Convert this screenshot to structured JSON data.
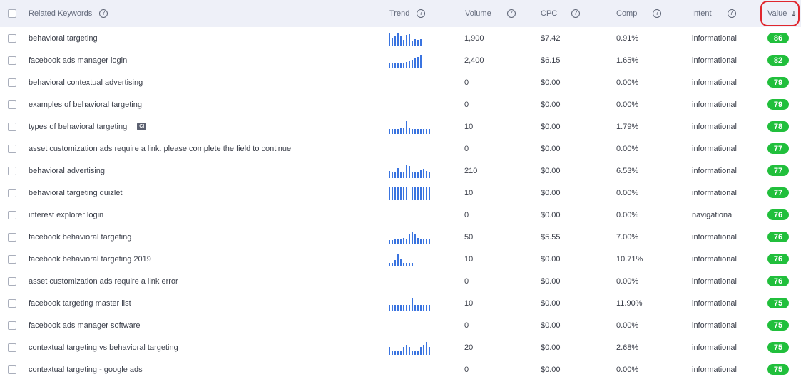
{
  "header": {
    "keyword_label": "Related Keywords",
    "trend_label": "Trend",
    "volume_label": "Volume",
    "cpc_label": "CPC",
    "comp_label": "Comp",
    "intent_label": "Intent",
    "value_label": "Value",
    "sort_icon": "arrow-down-icon",
    "help_icon": "help-circle-icon",
    "help_glyph": "?",
    "sort_glyph": "↓"
  },
  "colors": {
    "header_bg": "#eef0f8",
    "trend_bar": "#3a74e0",
    "value_pill": "#21bf3c",
    "highlight_ring": "#e0262d"
  },
  "rows": [
    {
      "keyword": "behavioral targeting",
      "volume": "1,900",
      "cpc": "$7.42",
      "comp": "0.91%",
      "intent": "informational",
      "value": "86",
      "trend": [
        0.95,
        0.55,
        0.75,
        1.0,
        0.7,
        0.45,
        0.85,
        0.9,
        0.4,
        0.5,
        0.45,
        0.5
      ]
    },
    {
      "keyword": "facebook ads manager login",
      "volume": "2,400",
      "cpc": "$6.15",
      "comp": "1.65%",
      "intent": "informational",
      "value": "82",
      "trend": [
        0.35,
        0.35,
        0.35,
        0.35,
        0.4,
        0.4,
        0.45,
        0.55,
        0.6,
        0.75,
        0.85,
        1.0
      ]
    },
    {
      "keyword": "behavioral contextual advertising",
      "volume": "0",
      "cpc": "$0.00",
      "comp": "0.00%",
      "intent": "informational",
      "value": "79",
      "trend": []
    },
    {
      "keyword": "examples of behavioral targeting",
      "volume": "0",
      "cpc": "$0.00",
      "comp": "0.00%",
      "intent": "informational",
      "value": "79",
      "trend": []
    },
    {
      "keyword": "types of behavioral targeting",
      "badge": "CI",
      "volume": "10",
      "cpc": "$0.00",
      "comp": "1.79%",
      "intent": "informational",
      "value": "78",
      "trend": [
        0.4,
        0.4,
        0.4,
        0.4,
        0.45,
        0.45,
        1.0,
        0.45,
        0.4,
        0.4,
        0.4,
        0.4,
        0.4,
        0.4,
        0.4
      ]
    },
    {
      "keyword": "asset customization ads require a link. please complete the field to continue",
      "volume": "0",
      "cpc": "$0.00",
      "comp": "0.00%",
      "intent": "informational",
      "value": "77",
      "trend": []
    },
    {
      "keyword": "behavioral advertising",
      "volume": "210",
      "cpc": "$0.00",
      "comp": "6.53%",
      "intent": "informational",
      "value": "77",
      "trend": [
        0.55,
        0.45,
        0.5,
        0.8,
        0.45,
        0.5,
        1.0,
        0.95,
        0.45,
        0.45,
        0.5,
        0.6,
        0.7,
        0.55,
        0.5
      ]
    },
    {
      "keyword": "behavioral targeting quizlet",
      "volume": "10",
      "cpc": "$0.00",
      "comp": "0.00%",
      "intent": "informational",
      "value": "77",
      "trend": [
        1.0,
        1.0,
        1.0,
        1.0,
        1.0,
        1.0,
        1.0,
        0.0,
        1.0,
        1.0,
        1.0,
        1.0,
        1.0,
        1.0,
        1.0
      ]
    },
    {
      "keyword": "interest explorer login",
      "volume": "0",
      "cpc": "$0.00",
      "comp": "0.00%",
      "intent": "navigational",
      "value": "76",
      "trend": []
    },
    {
      "keyword": "facebook behavioral targeting",
      "volume": "50",
      "cpc": "$5.55",
      "comp": "7.00%",
      "intent": "informational",
      "value": "76",
      "trend": [
        0.35,
        0.35,
        0.4,
        0.4,
        0.45,
        0.5,
        0.45,
        0.75,
        1.0,
        0.75,
        0.5,
        0.45,
        0.4,
        0.4,
        0.4
      ]
    },
    {
      "keyword": "facebook behavioral targeting 2019",
      "volume": "10",
      "cpc": "$0.00",
      "comp": "10.71%",
      "intent": "informational",
      "value": "76",
      "trend": [
        0.3,
        0.3,
        0.5,
        1.0,
        0.6,
        0.25,
        0.25,
        0.25,
        0.25
      ]
    },
    {
      "keyword": "asset customization ads require a link error",
      "volume": "0",
      "cpc": "$0.00",
      "comp": "0.00%",
      "intent": "informational",
      "value": "76",
      "trend": []
    },
    {
      "keyword": "facebook targeting master list",
      "volume": "10",
      "cpc": "$0.00",
      "comp": "11.90%",
      "intent": "informational",
      "value": "75",
      "trend": [
        0.45,
        0.45,
        0.45,
        0.45,
        0.45,
        0.45,
        0.45,
        0.45,
        1.0,
        0.45,
        0.45,
        0.45,
        0.45,
        0.45,
        0.45
      ]
    },
    {
      "keyword": "facebook ads manager software",
      "volume": "0",
      "cpc": "$0.00",
      "comp": "0.00%",
      "intent": "informational",
      "value": "75",
      "trend": []
    },
    {
      "keyword": "contextual targeting vs behavioral targeting",
      "volume": "20",
      "cpc": "$0.00",
      "comp": "2.68%",
      "intent": "informational",
      "value": "75",
      "trend": [
        0.6,
        0.25,
        0.25,
        0.25,
        0.25,
        0.6,
        0.75,
        0.6,
        0.25,
        0.25,
        0.25,
        0.6,
        0.75,
        1.0,
        0.6
      ]
    },
    {
      "keyword": "contextual targeting - google ads",
      "volume": "0",
      "cpc": "$0.00",
      "comp": "0.00%",
      "intent": "informational",
      "value": "75",
      "trend": []
    }
  ]
}
